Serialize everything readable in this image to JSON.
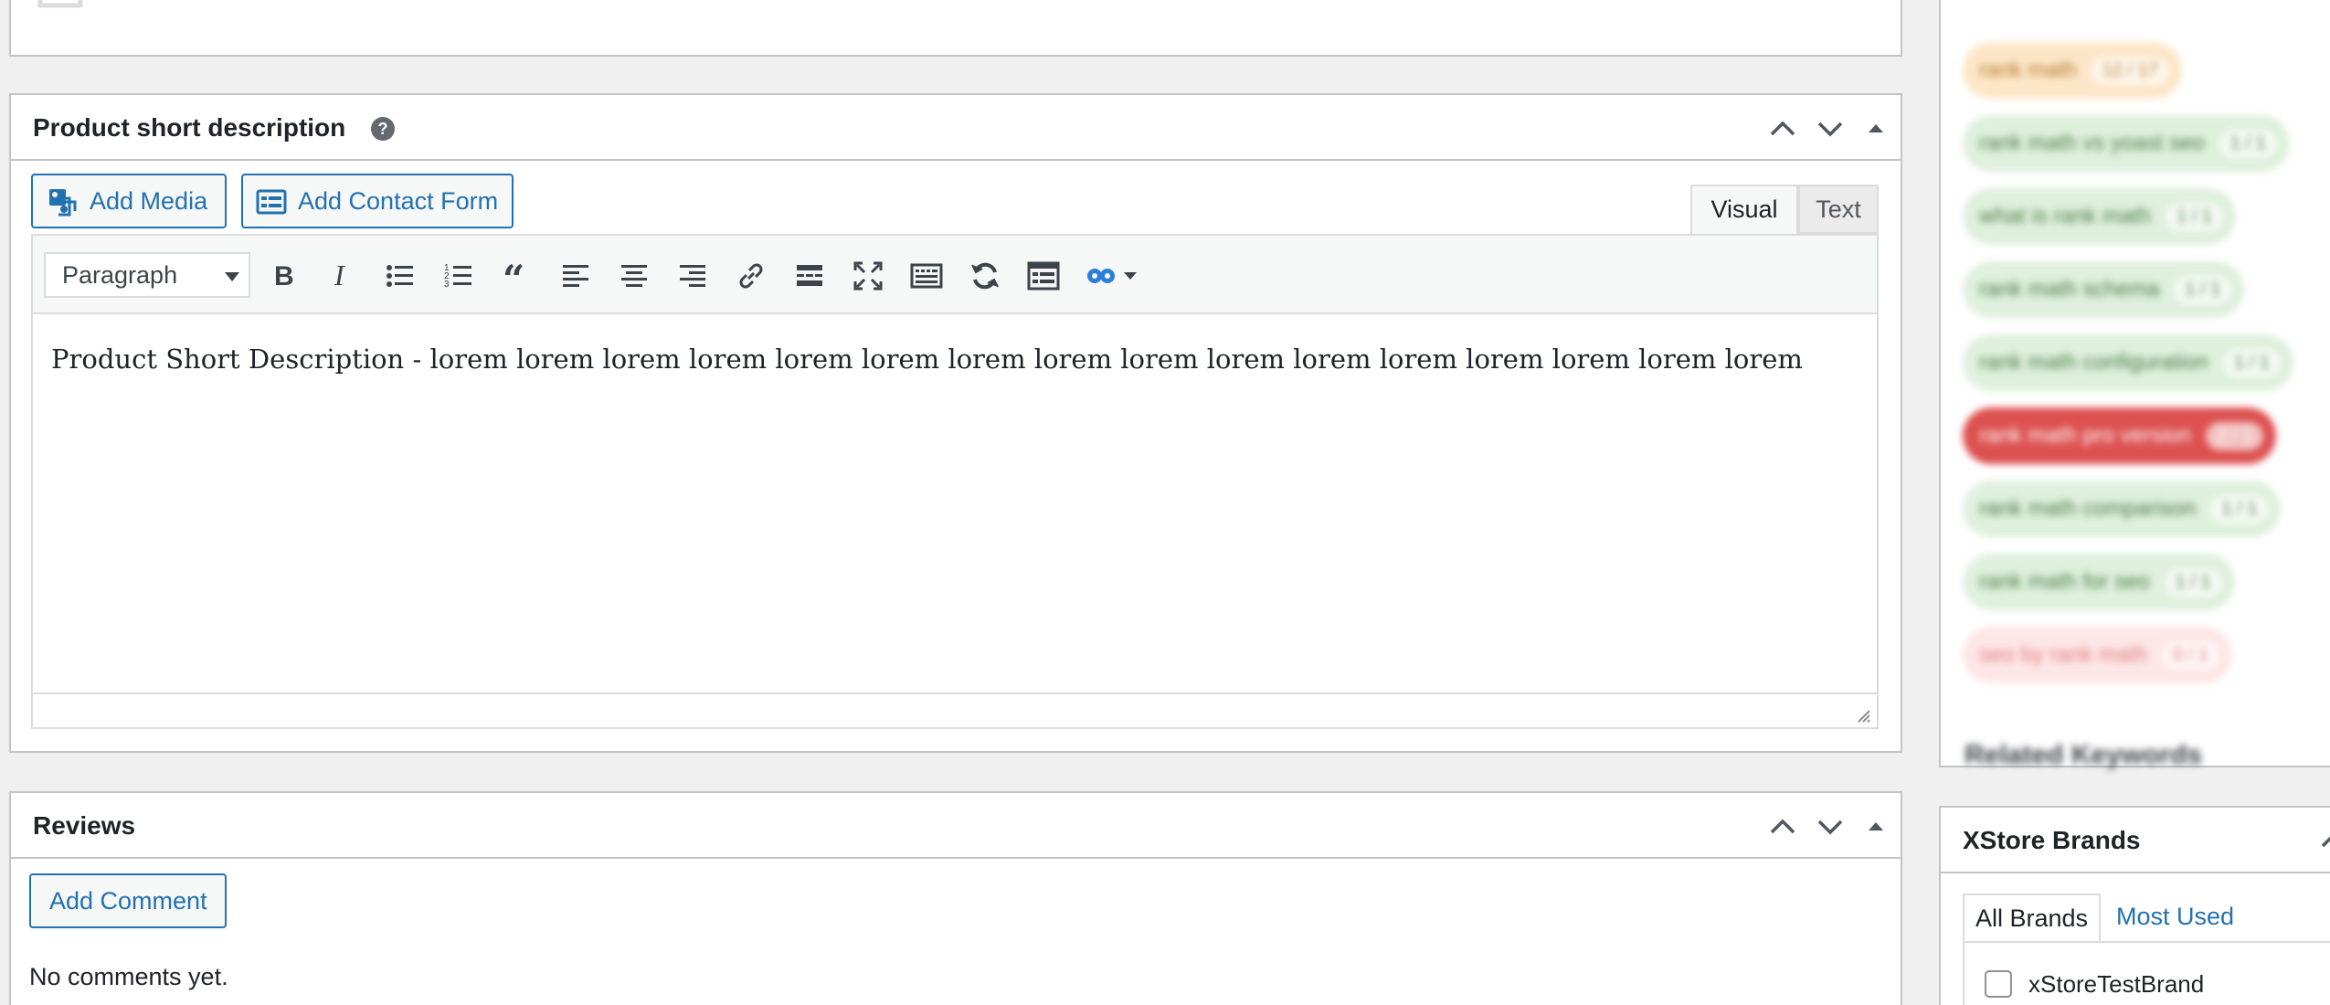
{
  "short_description": {
    "title": "Product short description",
    "help_icon": "help-icon",
    "add_media_label": "Add Media",
    "add_contact_form_label": "Add Contact Form",
    "tab_visual": "Visual",
    "tab_text": "Text",
    "format_value": "Paragraph",
    "content": "Product Short Description - lorem lorem lorem lorem lorem lorem lorem lorem lorem lorem lorem lorem lorem lorem lorem lorem",
    "toolbar_icons": [
      "bold-icon",
      "italic-icon",
      "bullet-list-icon",
      "numbered-list-icon",
      "blockquote-icon",
      "align-left-icon",
      "align-center-icon",
      "align-right-icon",
      "link-icon",
      "read-more-icon",
      "fullscreen-icon",
      "toolbar-toggle-icon",
      "refresh-icon",
      "form-icon",
      "infinity-icon"
    ]
  },
  "reviews": {
    "title": "Reviews",
    "add_comment_label": "Add Comment",
    "empty_text": "No comments yet."
  },
  "keywords": {
    "pills": [
      {
        "label": "rank math",
        "count": "12 / 17",
        "color": "orange"
      },
      {
        "label": "rank math vs yoast seo",
        "count": "1 / 1",
        "color": "green"
      },
      {
        "label": "what is rank math",
        "count": "1 / 1",
        "color": "green"
      },
      {
        "label": "rank math schema",
        "count": "1 / 1",
        "color": "green"
      },
      {
        "label": "rank math configuration",
        "count": "1 / 1",
        "color": "green"
      },
      {
        "label": "rank math pro version",
        "count": "2 / 1",
        "color": "red"
      },
      {
        "label": "rank math comparison",
        "count": "1 / 1",
        "color": "green"
      },
      {
        "label": "rank math for seo",
        "count": "1 / 1",
        "color": "green"
      },
      {
        "label": "seo by rank math",
        "count": "0 / 1",
        "color": "pink"
      }
    ],
    "related_heading": "Related Keywords"
  },
  "brands": {
    "title": "XStore Brands",
    "tab_all": "All Brands",
    "tab_most_used": "Most Used",
    "items": [
      {
        "label": "xStoreTestBrand",
        "checked": false
      }
    ]
  },
  "colors": {
    "accent": "#2271b1",
    "border": "#c3c4c7",
    "background": "#f0f0f1"
  }
}
